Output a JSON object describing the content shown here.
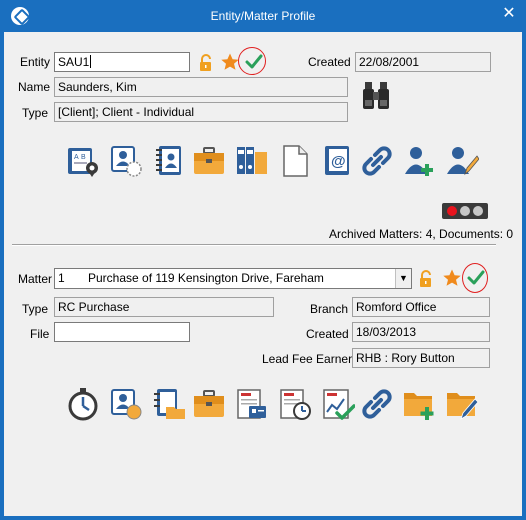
{
  "window": {
    "title": "Entity/Matter Profile",
    "close_glyph": "✕"
  },
  "entity": {
    "entity_label": "Entity",
    "entity_value": "SAU1",
    "name_label": "Name",
    "name_value": "Saunders, Kim",
    "type_label": "Type",
    "type_value": "[Client]; Client - Individual",
    "created_label": "Created",
    "created_value": "22/08/2001",
    "toolbar_icons": [
      "address-book-icon",
      "contact-card-icon",
      "notebook-contact-icon",
      "briefcase-icon",
      "binders-icon",
      "blank-document-icon",
      "email-book-icon",
      "chain-link-icon",
      "add-person-icon",
      "edit-person-icon"
    ],
    "archived_text": "Archived Matters: 4, Documents: 0"
  },
  "matter": {
    "matter_label": "Matter",
    "matter_number": "1",
    "matter_description": "Purchase of 119 Kensington Drive, Fareham",
    "type_label": "Type",
    "type_value": "RC Purchase",
    "branch_label": "Branch",
    "branch_value": "Romford Office",
    "file_label": "File",
    "file_value": "",
    "created_label": "Created",
    "created_value": "18/03/2013",
    "fee_earner_label": "Lead Fee Earner",
    "fee_earner_value": "RHB : Rory Button",
    "toolbar_icons": [
      "stopwatch-icon",
      "contact-card-icon",
      "notebook-folder-icon",
      "briefcase-icon",
      "invoice-icon",
      "invoice-clock-icon",
      "chart-document-icon",
      "cheque-icon",
      "chain-link-icon",
      "add-folder-icon",
      "edit-folder-icon"
    ]
  },
  "colors": {
    "titlebar": "#1a6fbf",
    "accent_blue": "#1f5fa8",
    "lock_orange": "#f0a020",
    "star_orange": "#f08a1c",
    "check_green": "#2aa05a",
    "annotation_red": "#e02020",
    "traffic_red": "#e8141e"
  }
}
